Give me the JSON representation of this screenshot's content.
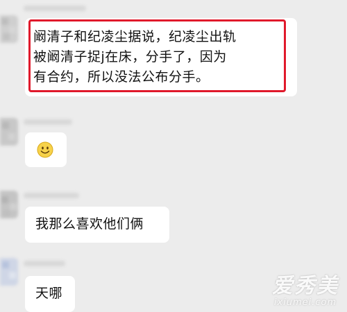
{
  "messages": [
    {
      "text_lines": [
        "阚清子和纪凌尘据说，纪凌尘出轨",
        "被阚清子捉j在床，分手了，因为",
        "有合约，所以没法公布分手。"
      ]
    },
    {
      "emoji": "smiley-emoji"
    },
    {
      "text": "我那么喜欢他们俩"
    },
    {
      "text": "天哪"
    }
  ],
  "watermark": {
    "main": "爱秀美",
    "sub": "ixiumei.com"
  },
  "colors": {
    "background": "#ececec",
    "bubble": "#ffffff",
    "highlight_border": "#e0192b"
  }
}
